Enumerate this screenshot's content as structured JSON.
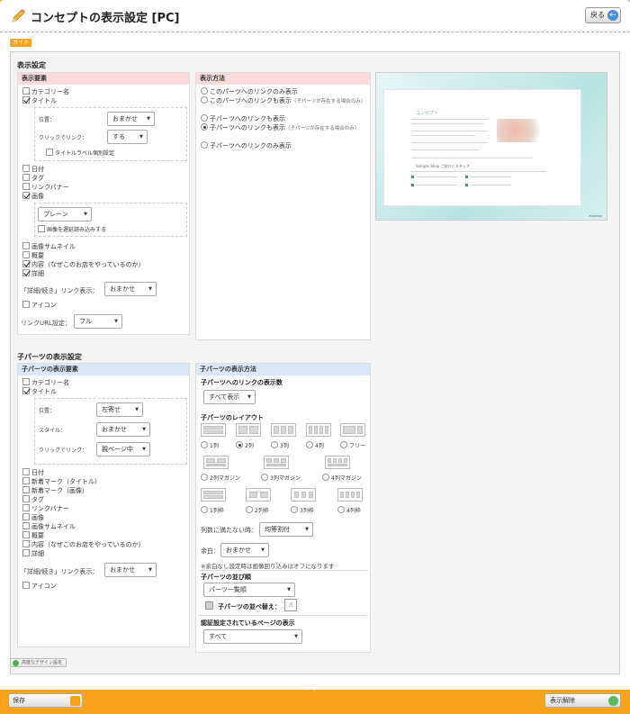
{
  "title": "コンセプトの表示設定 [PC]",
  "back_label": "戻る",
  "guide_badge": "ガイド",
  "display_settings": {
    "section_title": "表示設定",
    "elements_head": "表示要素",
    "method_head": "表示方法",
    "items": [
      {
        "label": "カテゴリー名",
        "checked": false
      },
      {
        "label": "タイトル",
        "checked": true
      }
    ],
    "title_sub": {
      "position_label": "位置：",
      "position_value": "おまかせ",
      "click_label": "クリックでリンク：",
      "click_value": "する",
      "title_label_setting": "タイトルラベル個別設定"
    },
    "items2": [
      {
        "label": "日付",
        "checked": false
      },
      {
        "label": "タグ",
        "checked": false
      },
      {
        "label": "リンクバナー",
        "checked": false
      },
      {
        "label": "画像",
        "checked": true
      }
    ],
    "image_sub": {
      "style_value": "プレーン",
      "lazy_load": "画像を遅延読み込みする"
    },
    "items3": [
      {
        "label": "画像サムネイル",
        "checked": false
      },
      {
        "label": "概要",
        "checked": false
      },
      {
        "label": "内容（なぜこのお店をやっているのか）",
        "checked": true
      },
      {
        "label": "詳細",
        "checked": true
      }
    ],
    "detail_link_label": "「詳細/続き」リンク表示：",
    "detail_link_value": "おまかせ",
    "icon_label": "アイコン",
    "link_url_label": "リンクURL設定：",
    "link_url_value": "フル",
    "methods": [
      {
        "label": "このパーツへのリンクのみ表示",
        "note": "",
        "selected": false
      },
      {
        "label": "このパーツへのリンクも表示",
        "note": "（子パーツが存在する場合のみ）",
        "selected": false
      },
      {
        "label": "子パーツへのリンクも表示",
        "note": "",
        "selected": false
      },
      {
        "label": "子パーツへのリンクも表示",
        "note": "（子パーツが存在する場合のみ）",
        "selected": true
      },
      {
        "label": "子パーツへのリンクのみ表示",
        "note": "",
        "selected": false
      }
    ]
  },
  "preview": {
    "title": "コンセプト",
    "caption": "Sample Shop ご紹介とスタッフ",
    "footer": "FORSTAM"
  },
  "child_settings": {
    "section_title": "子パーツの表示設定",
    "elements_head": "子パーツの表示要素",
    "method_head": "子パーツの表示方法",
    "items": [
      {
        "label": "カテゴリー名",
        "checked": false
      },
      {
        "label": "タイトル",
        "checked": true
      }
    ],
    "title_sub": {
      "position_label": "位置：",
      "position_value": "左寄せ",
      "style_label": "スタイル：",
      "style_value": "おまかせ",
      "click_label": "クリックでリンク：",
      "click_value": "親ページ中"
    },
    "items2": [
      {
        "label": "日付",
        "checked": false
      },
      {
        "label": "新着マーク（タイトル）",
        "checked": false
      },
      {
        "label": "新着マーク（画像）",
        "checked": false
      },
      {
        "label": "タグ",
        "checked": false
      },
      {
        "label": "リンクバナー",
        "checked": false
      },
      {
        "label": "画像",
        "checked": false
      },
      {
        "label": "画像サムネイル",
        "checked": false
      },
      {
        "label": "概要",
        "checked": false
      },
      {
        "label": "内容（なぜこのお店をやっているのか）",
        "checked": false
      },
      {
        "label": "詳細",
        "checked": false
      }
    ],
    "detail_link_label": "「詳細/続き」リンク表示：",
    "detail_link_value": "おまかせ",
    "icon_label": "アイコン",
    "link_count_title": "子パーツへのリンクの表示数",
    "link_count_value": "すべて表示",
    "layout_title": "子パーツのレイアウト",
    "layouts_row1": [
      {
        "label": "1列",
        "selected": false
      },
      {
        "label": "2列",
        "selected": true
      },
      {
        "label": "3列",
        "selected": false
      },
      {
        "label": "4列",
        "selected": false
      },
      {
        "label": "フリー",
        "selected": false
      }
    ],
    "layouts_row2": [
      {
        "label": "2列マガジン",
        "selected": false
      },
      {
        "label": "3列マガジン",
        "selected": false
      },
      {
        "label": "4列マガジン",
        "selected": false
      }
    ],
    "layouts_row3": [
      {
        "label": "1列枠",
        "selected": false
      },
      {
        "label": "2列枠",
        "selected": false
      },
      {
        "label": "3列枠",
        "selected": false
      },
      {
        "label": "4列枠",
        "selected": false
      }
    ],
    "shortfall_label": "列数に満たない時：",
    "shortfall_value": "均等割付",
    "margin_label": "余白：",
    "margin_value": "おまかせ",
    "margin_note": "※余白なし設定時は画像回り込みはオフになります",
    "order_title": "子パーツの並び順",
    "order_value": "パーツ一覧順",
    "sort_label": "子パーツの並べ替え：",
    "auth_title": "認証設定されているページの表示",
    "auth_value": "すべて"
  },
  "advanced_label": "高度なデザイン設定",
  "save_label": "保存",
  "unpublish_label": "表示解除"
}
